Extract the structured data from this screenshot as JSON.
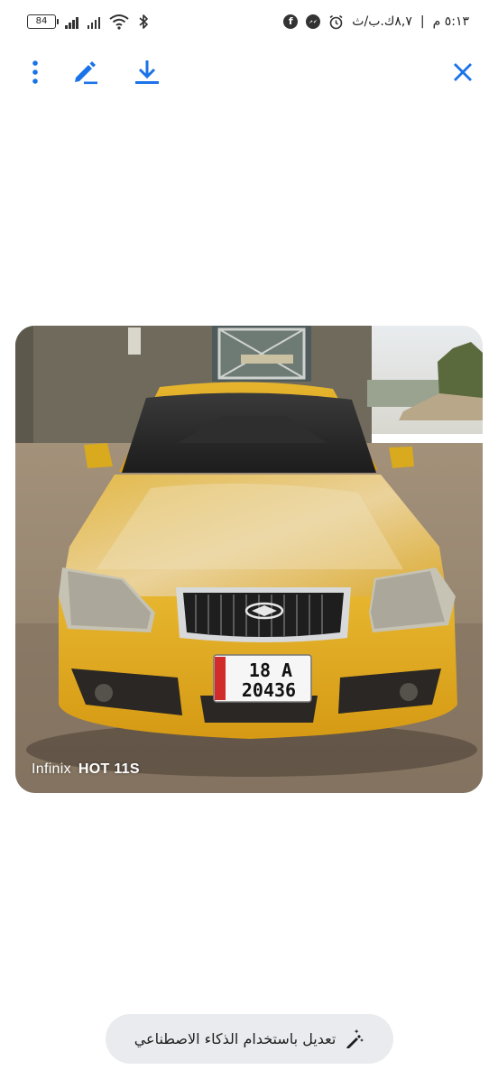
{
  "status_bar": {
    "time": "٥:١٣ م",
    "data_speed": "٨,٧ك.ب/ث",
    "battery_level": "84",
    "icons": [
      "facebook-icon",
      "messenger-icon",
      "alarm-icon",
      "bluetooth-icon",
      "wifi-icon",
      "signal-icon",
      "battery-icon"
    ]
  },
  "toolbar": {
    "more_icon": "more-vert-icon",
    "edit_icon": "edit-pen-icon",
    "download_icon": "download-icon",
    "close_icon": "close-icon",
    "accent_color": "#1a73e8"
  },
  "photo": {
    "watermark_brand": "Infinix",
    "watermark_model": "HOT 11S",
    "plate_line1": "18  A",
    "plate_line2": "20436"
  },
  "ai_edit_button": {
    "label": "تعديل باستخدام الذكاء الاصطناعي",
    "icon": "magic-pen-icon"
  }
}
